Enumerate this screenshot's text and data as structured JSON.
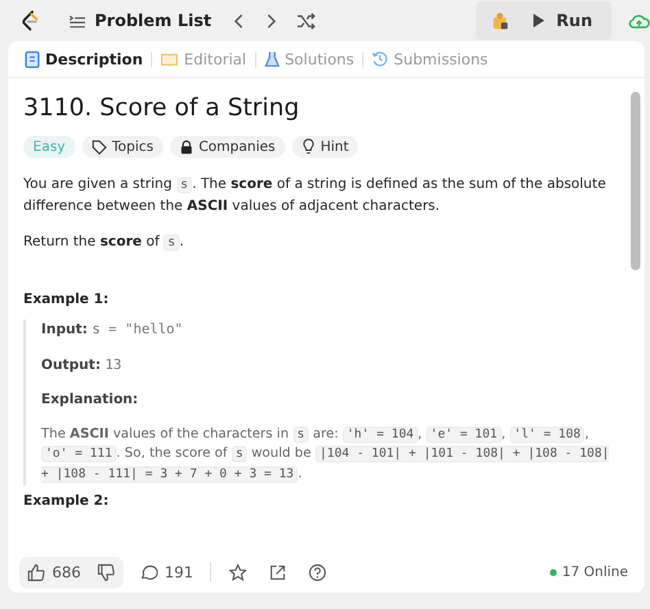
{
  "topbar": {
    "title": "Problem List",
    "run": "Run"
  },
  "tabs": [
    {
      "label": "Description",
      "kind": "doc",
      "selected": true
    },
    {
      "label": "Editorial",
      "kind": "book",
      "selected": false
    },
    {
      "label": "Solutions",
      "kind": "flask",
      "selected": false
    },
    {
      "label": "Submissions",
      "kind": "history",
      "selected": false
    }
  ],
  "problem": {
    "title": "3110. Score of a String",
    "tags": [
      {
        "label": "Easy",
        "kind": "difficulty"
      },
      {
        "label": "Topics",
        "kind": "tag"
      },
      {
        "label": "Companies",
        "kind": "lock"
      },
      {
        "label": "Hint",
        "kind": "bulb"
      }
    ],
    "paragraphs": [
      [
        {
          "kind": "text",
          "text": "You are given a string "
        },
        {
          "kind": "code",
          "text": "s"
        },
        {
          "kind": "text",
          "text": ". The **score** of a string is defined as the sum of the absolute difference between the **ASCII** values of adjacent characters."
        }
      ],
      [
        {
          "kind": "text",
          "text": "Return the **score** of "
        },
        {
          "kind": "code",
          "text": "s"
        },
        {
          "kind": "text",
          "text": "."
        }
      ]
    ],
    "examples": [
      {
        "heading": "Example 1:",
        "input_label": "Input:",
        "input": "s = \"hello\"",
        "output_label": "Output:",
        "output": "13",
        "explanation_label": "Explanation:",
        "explanation": [
          {
            "kind": "text",
            "text": "The **ASCII** values of the characters in "
          },
          {
            "kind": "code",
            "text": "s"
          },
          {
            "kind": "text",
            "text": " are: "
          },
          {
            "kind": "code",
            "text": "'h' = 104"
          },
          {
            "kind": "text",
            "text": ", "
          },
          {
            "kind": "code",
            "text": "'e' = 101"
          },
          {
            "kind": "text",
            "text": ", "
          },
          {
            "kind": "code",
            "text": "'l' = 108"
          },
          {
            "kind": "text",
            "text": ", "
          },
          {
            "kind": "code",
            "text": "'o' = 111"
          },
          {
            "kind": "text",
            "text": ". So, the score of "
          },
          {
            "kind": "code",
            "text": "s"
          },
          {
            "kind": "text",
            "text": " would be "
          },
          {
            "kind": "code",
            "text": "|104 - 101| + |101 - 108| + |108 - 108| + |108 - 111| = 3 + 7 + 0 + 3 = 13"
          },
          {
            "kind": "text",
            "text": "."
          }
        ]
      },
      {
        "heading": "Example 2:"
      }
    ]
  },
  "footer": {
    "likes": "686",
    "comments": "191",
    "online": "17 Online"
  }
}
